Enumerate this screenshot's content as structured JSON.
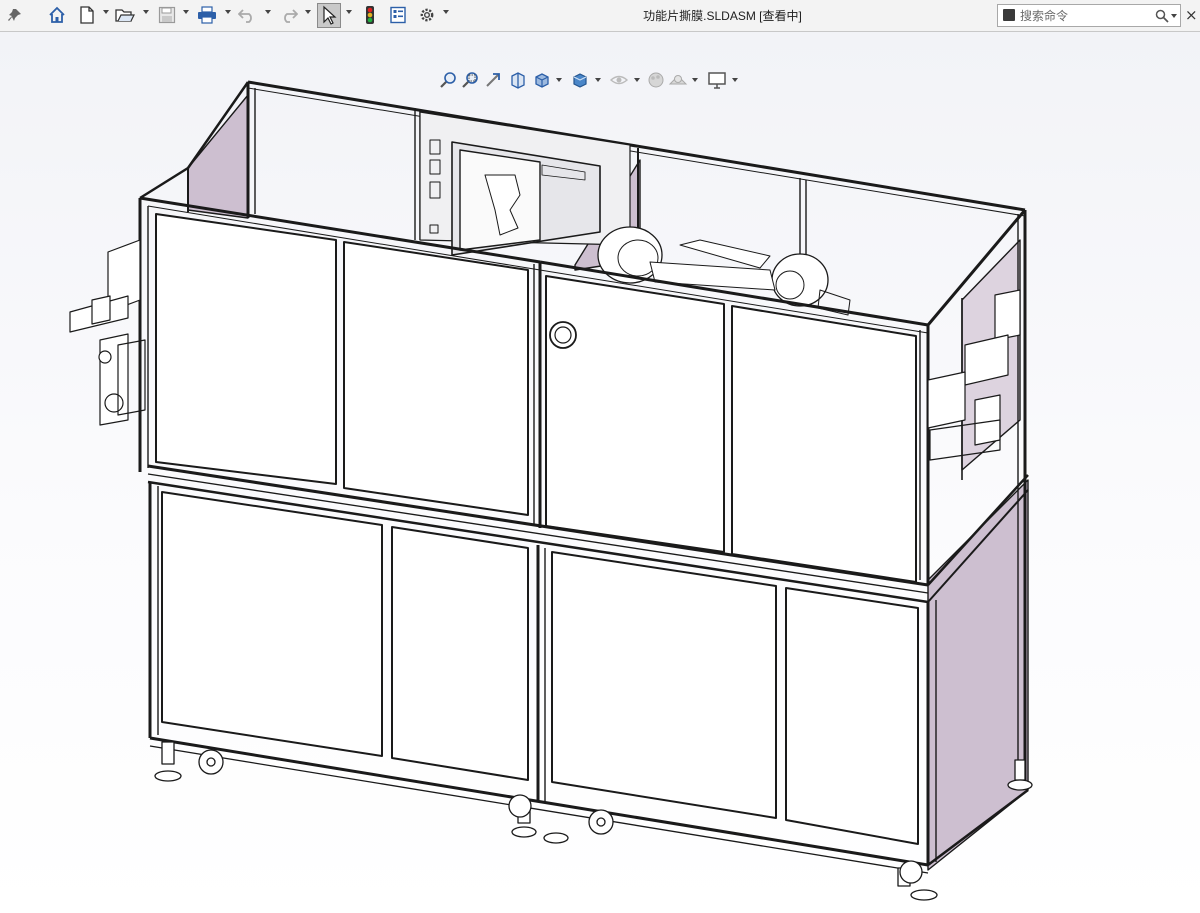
{
  "window": {
    "title": "功能片撕膜.SLDASM [查看中]"
  },
  "toolbar": {
    "items": [
      {
        "name": "pin-icon"
      },
      {
        "name": "home-icon"
      },
      {
        "name": "new-document-icon"
      },
      {
        "name": "open-icon"
      },
      {
        "name": "save-icon"
      },
      {
        "name": "print-icon"
      },
      {
        "name": "undo-icon"
      },
      {
        "name": "redo-icon"
      },
      {
        "name": "select-cursor-icon"
      },
      {
        "name": "rebuild-traffic-light-icon"
      },
      {
        "name": "file-properties-icon"
      },
      {
        "name": "options-gear-icon"
      }
    ]
  },
  "search": {
    "placeholder": "搜索命令"
  },
  "view_toolbar": {
    "items": [
      "zoom-to-fit-icon",
      "zoom-to-area-icon",
      "previous-view-icon",
      "section-view-icon",
      "view-orientation-icon",
      "display-style-icon",
      "hide-show-items-icon",
      "edit-appearance-icon",
      "apply-scene-icon",
      "view-settings-icon"
    ]
  },
  "colors": {
    "toolbar_bg": "#f3f3f3",
    "frame_line": "#1a1a1a",
    "panel_tint": "#cdbfd0",
    "canvas_bg": "#f2f3f7"
  }
}
